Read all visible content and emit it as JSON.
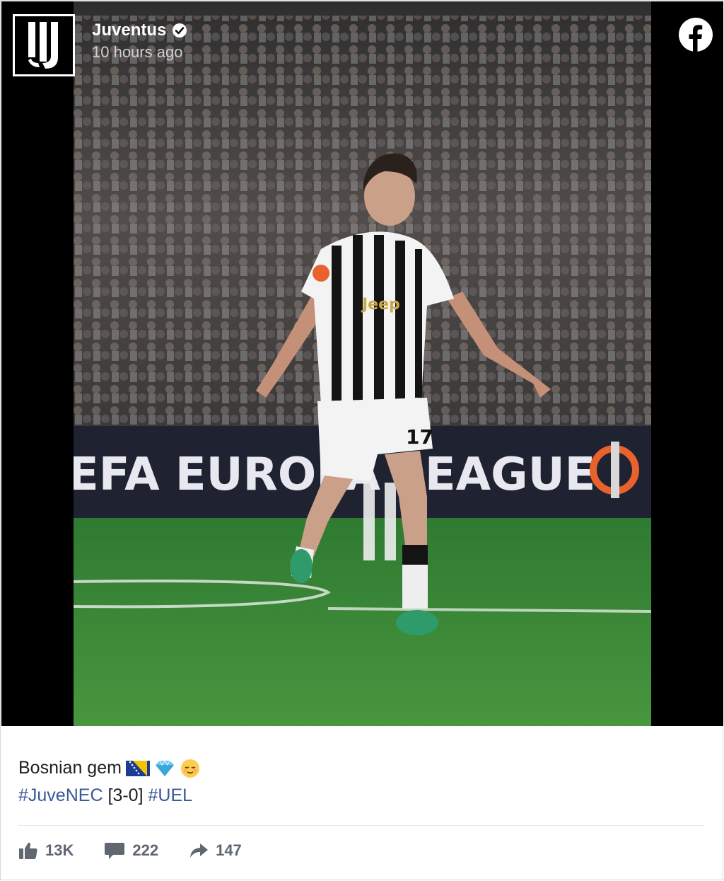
{
  "post": {
    "page_name": "Juventus",
    "timestamp": "10 hours ago",
    "caption_text": "Bosnian gem",
    "hashtag_1": "#JuveNEC",
    "score": "[3-0]",
    "hashtag_2": "#UEL"
  },
  "photo": {
    "banner_text": "EFA EUROPA LEAGUE",
    "jersey_sponsor": "Jeep",
    "shorts_number": "17"
  },
  "icons": {
    "logo": "juventus-logo",
    "verified": "verified-badge-icon",
    "facebook": "facebook-icon",
    "like": "thumbs-up-icon",
    "comment": "comment-icon",
    "share": "share-arrow-icon"
  },
  "stats": {
    "likes": "13K",
    "comments": "222",
    "shares": "147"
  },
  "colors": {
    "hashtag": "#385898",
    "pitch": "#3c8a3a",
    "banner": "#1f2230"
  }
}
